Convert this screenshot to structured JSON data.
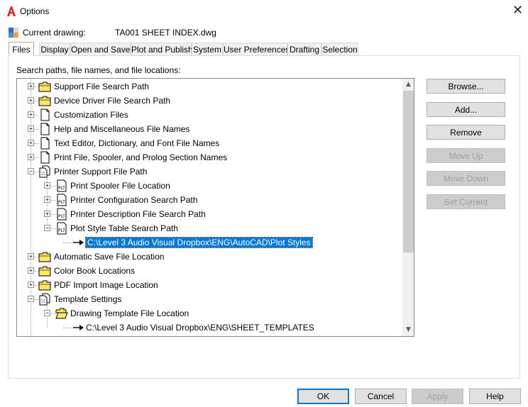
{
  "window": {
    "title": "Options",
    "close_glyph": "✕"
  },
  "current_drawing": {
    "label": "Current drawing:",
    "value": "TA001 SHEET INDEX.dwg"
  },
  "tabs": [
    {
      "label": "Files",
      "active": true
    },
    {
      "label": "Display"
    },
    {
      "label": "Open and Save"
    },
    {
      "label": "Plot and Publish"
    },
    {
      "label": "System"
    },
    {
      "label": "User Preferences"
    },
    {
      "label": "Drafting"
    },
    {
      "label": "Selection"
    }
  ],
  "files_tab": {
    "section_label": "Search paths, file names, and file locations:",
    "tree": [
      {
        "label": "Support File Search Path",
        "level": 0,
        "icon": "folder-icon",
        "expander": "+"
      },
      {
        "label": "Device Driver File Search Path",
        "level": 0,
        "icon": "folder-icon",
        "expander": "+"
      },
      {
        "label": "Customization Files",
        "level": 0,
        "icon": "document-icon",
        "expander": "+"
      },
      {
        "label": "Help and Miscellaneous File Names",
        "level": 0,
        "icon": "document-icon",
        "expander": "+"
      },
      {
        "label": "Text Editor, Dictionary, and Font File Names",
        "level": 0,
        "icon": "document-icon",
        "expander": "+"
      },
      {
        "label": "Print File, Spooler, and Prolog Section Names",
        "level": 0,
        "icon": "document-icon",
        "expander": "+"
      },
      {
        "label": "Printer Support File Path",
        "level": 0,
        "icon": "documents-icon",
        "expander": "−"
      },
      {
        "label": "Print Spooler File Location",
        "level": 1,
        "icon": "plot-file-icon",
        "expander": "+"
      },
      {
        "label": "Printer Configuration Search Path",
        "level": 1,
        "icon": "plot-file-icon",
        "expander": "+"
      },
      {
        "label": "Printer Description File Search Path",
        "level": 1,
        "icon": "plot-file-icon",
        "expander": "+"
      },
      {
        "label": "Plot Style Table Search Path",
        "level": 1,
        "icon": "plot-file-icon",
        "expander": "−"
      },
      {
        "label": "C:\\Level 3 Audio Visual Dropbox\\ENG\\AutoCAD\\Plot Styles",
        "level": 2,
        "icon": "arrow-icon",
        "selected": true
      },
      {
        "label": "Automatic Save File Location",
        "level": 0,
        "icon": "folder-icon",
        "expander": "+"
      },
      {
        "label": "Color Book Locations",
        "level": 0,
        "icon": "folder-icon",
        "expander": "+"
      },
      {
        "label": "PDF Import Image Location",
        "level": 0,
        "icon": "folder-icon",
        "expander": "+"
      },
      {
        "label": "Template Settings",
        "level": 0,
        "icon": "documents-icon",
        "expander": "−"
      },
      {
        "label": "Drawing Template File Location",
        "level": 1,
        "icon": "open-folder-icon",
        "expander": "−"
      },
      {
        "label": "C:\\Level 3 Audio Visual Dropbox\\ENG\\SHEET_TEMPLATES",
        "level": 2,
        "icon": "arrow-icon"
      }
    ],
    "side_buttons": [
      {
        "label": "Browse...",
        "enabled": true
      },
      {
        "label": "Add...",
        "enabled": true
      },
      {
        "label": "Remove",
        "enabled": true
      },
      {
        "label": "Move Up",
        "enabled": false
      },
      {
        "label": "Move Down",
        "enabled": false
      },
      {
        "label": "Set Current",
        "enabled": false
      }
    ]
  },
  "footer": {
    "ok": "OK",
    "cancel": "Cancel",
    "apply": "Apply",
    "help": "Help"
  },
  "colors": {
    "selection": "#0078d7",
    "folder": "#ffe666",
    "brand_red": "#e51b24"
  }
}
